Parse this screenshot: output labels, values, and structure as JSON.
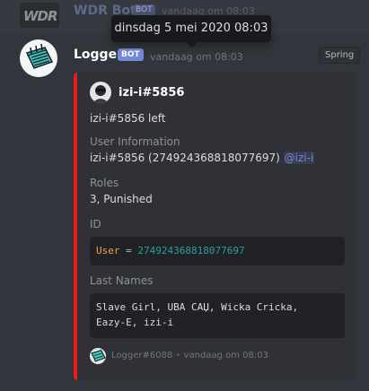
{
  "previous_message": {
    "username": "WDR Bot",
    "badge": "BOT",
    "timestamp": "vandaag om 08:03",
    "avatar_text": "WDR"
  },
  "tooltip": {
    "text": "dinsdag 5 mei 2020 08:03"
  },
  "message": {
    "username": "Logger",
    "badge": "BOT",
    "timestamp": "vandaag om 08:03",
    "tag": "Spring",
    "avatar_icon": "notepad-icon"
  },
  "embed": {
    "accent_color": "#ed1c16",
    "author": "izi-i#5856",
    "description": "izi-i#5856 left",
    "fields": {
      "user_info": {
        "name": "User Information",
        "value": "izi-i#5856 (274924368818077697) ",
        "mention": "@izi-i"
      },
      "roles": {
        "name": "Roles",
        "value": "3, Punished"
      },
      "id": {
        "name": "ID",
        "code_key": "User",
        "code_eq": " = ",
        "code_value": "274924368818077697"
      },
      "last_names": {
        "name": "Last Names",
        "line1": "Slave Girl, UBA CAЏ, Wicka Cricka,",
        "line2": "Eazy-E, izi-i"
      }
    },
    "footer": {
      "text": "Logger#6088",
      "separator": "•",
      "timestamp": "vandaag om 08:03"
    }
  }
}
